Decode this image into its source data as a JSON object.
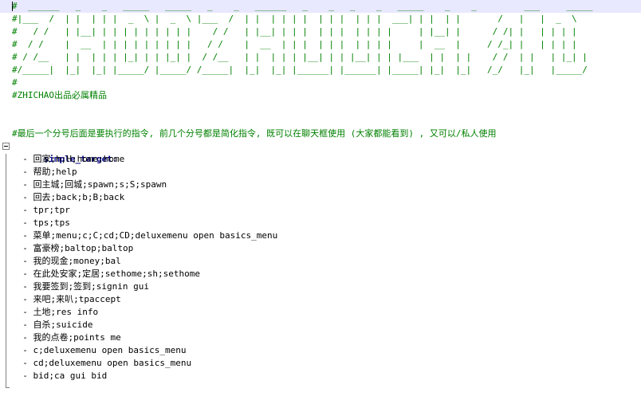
{
  "editor": {
    "lines": [
      {
        "kind": "comment",
        "text": "#  ______   _    _   _____   _____   _    _   ______   _    _   _    _   _____    _    _         ___     _____",
        "current": true
      },
      {
        "kind": "comment",
        "text": "#|___  /  | |  | | |  _  \\ |  _  \\ |___  /  | |  | | | |  | | |  | | |  ___| | |  | |       /   |   |  _  \\"
      },
      {
        "kind": "comment",
        "text": "#   / /   | |__| | | | | | | | | |    / /   | |__| | | |  | | |  | | | |     | |__| |      / /| |   | | | |"
      },
      {
        "kind": "comment",
        "text": "#  / /    |  __  | | | | | | | | |   / /    |  __  | | |  | | |  | | | |     |  __  |     / /_| |   | | | |"
      },
      {
        "kind": "comment",
        "text": "# / /__   | |  | | | |_| | | |_| |  / /__   | |  | | | |__| | | |__| | | |___  | |  | |    / /  | |   | |_| |"
      },
      {
        "kind": "comment",
        "text": "#/_____|  |_|  |_| |_____/ |_____/ /_____|  |_|  |_| |______| |______| |_____| |_|  |_|   /_/   |_|   |_____/"
      },
      {
        "kind": "comment",
        "text": "#"
      },
      {
        "kind": "comment",
        "text": "#ZHICHAO出品必属精品"
      },
      {
        "kind": "blank",
        "text": ""
      },
      {
        "kind": "blank",
        "text": ""
      },
      {
        "kind": "comment",
        "text": "#最后一个分号后面是要执行的指令, 前几个分号都是简化指令, 既可以在聊天框使用 (大家都能看到) , 又可以/私人使用"
      },
      {
        "kind": "key",
        "text": "simple_target:",
        "foldable": true
      },
      {
        "kind": "item",
        "text": "  - 回家;h;H;home;home"
      },
      {
        "kind": "item",
        "text": "  - 帮助;help"
      },
      {
        "kind": "item",
        "text": "  - 回主城;回城;spawn;s;S;spawn"
      },
      {
        "kind": "item",
        "text": "  - 回去;back;b;B;back"
      },
      {
        "kind": "item",
        "text": "  - tpr;tpr"
      },
      {
        "kind": "item",
        "text": "  - tps;tps"
      },
      {
        "kind": "item",
        "text": "  - 菜单;menu;c;C;cd;CD;deluxemenu open basics_menu"
      },
      {
        "kind": "item",
        "text": "  - 富豪榜;baltop;baltop"
      },
      {
        "kind": "item",
        "text": "  - 我的现金;money;bal"
      },
      {
        "kind": "item",
        "text": "  - 在此处安家;定居;sethome;sh;sethome"
      },
      {
        "kind": "item",
        "text": "  - 我要签到;签到;signin gui"
      },
      {
        "kind": "item",
        "text": "  - 来吧;来叭;tpaccept"
      },
      {
        "kind": "item",
        "text": "  - 土地;res info"
      },
      {
        "kind": "item",
        "text": "  - 自杀;suicide"
      },
      {
        "kind": "item",
        "text": "  - 我的点卷;points me"
      },
      {
        "kind": "item",
        "text": "  - c;deluxemenu open basics_menu"
      },
      {
        "kind": "item",
        "text": "  - cd;deluxemenu open basics_menu"
      },
      {
        "kind": "item",
        "text": "  - bid;ca gui bid"
      }
    ]
  }
}
